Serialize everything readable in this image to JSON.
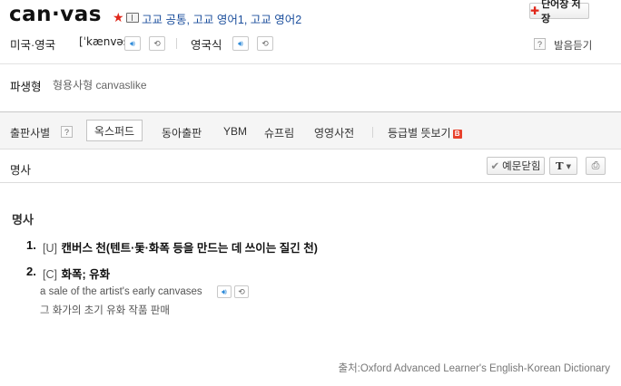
{
  "entry": {
    "headword": "can·vas",
    "star": "★",
    "levels": "고교 공통, 고교 영어1, 고교 영어2",
    "save_button": "단어장 저장",
    "pronunciations": [
      {
        "label": "미국·영국",
        "ipa": "[ˈkænvəs]"
      },
      {
        "label": "영국식",
        "ipa": ""
      }
    ],
    "listen_label": "발음듣기",
    "help_symbol": "?",
    "derivative": {
      "label": "파생형",
      "text": "형용사형 canvaslike"
    }
  },
  "publisher_tabs": {
    "label": "출판사별",
    "items": [
      "옥스퍼드",
      "동아출판",
      "YBM",
      "슈프림",
      "영영사전"
    ],
    "active_index": 0,
    "level_tab": "등급별 뜻보기",
    "new_badge": "B"
  },
  "pos_bar": {
    "label": "명사",
    "examples_button": "예문닫힘",
    "text_button": "T"
  },
  "definitions": {
    "section_title": "명사",
    "senses": [
      {
        "number": "1.",
        "grammar": "[U]",
        "meaning": "캔버스 천(텐트·돛·화폭 등을 만드는 데 쓰이는 질긴 천)"
      },
      {
        "number": "2.",
        "grammar": "[C]",
        "meaning": "화폭; 유화",
        "example": "a sale of the artist's early canvases",
        "translation": "그 화가의 초기 유화 작품 판매"
      }
    ]
  },
  "source": "출처:Oxford Advanced Learner's English-Korean Dictionary",
  "colors": {
    "accent_red": "#e0281b",
    "link_blue": "#1b4e9c",
    "speaker_blue": "#2a88d8"
  }
}
